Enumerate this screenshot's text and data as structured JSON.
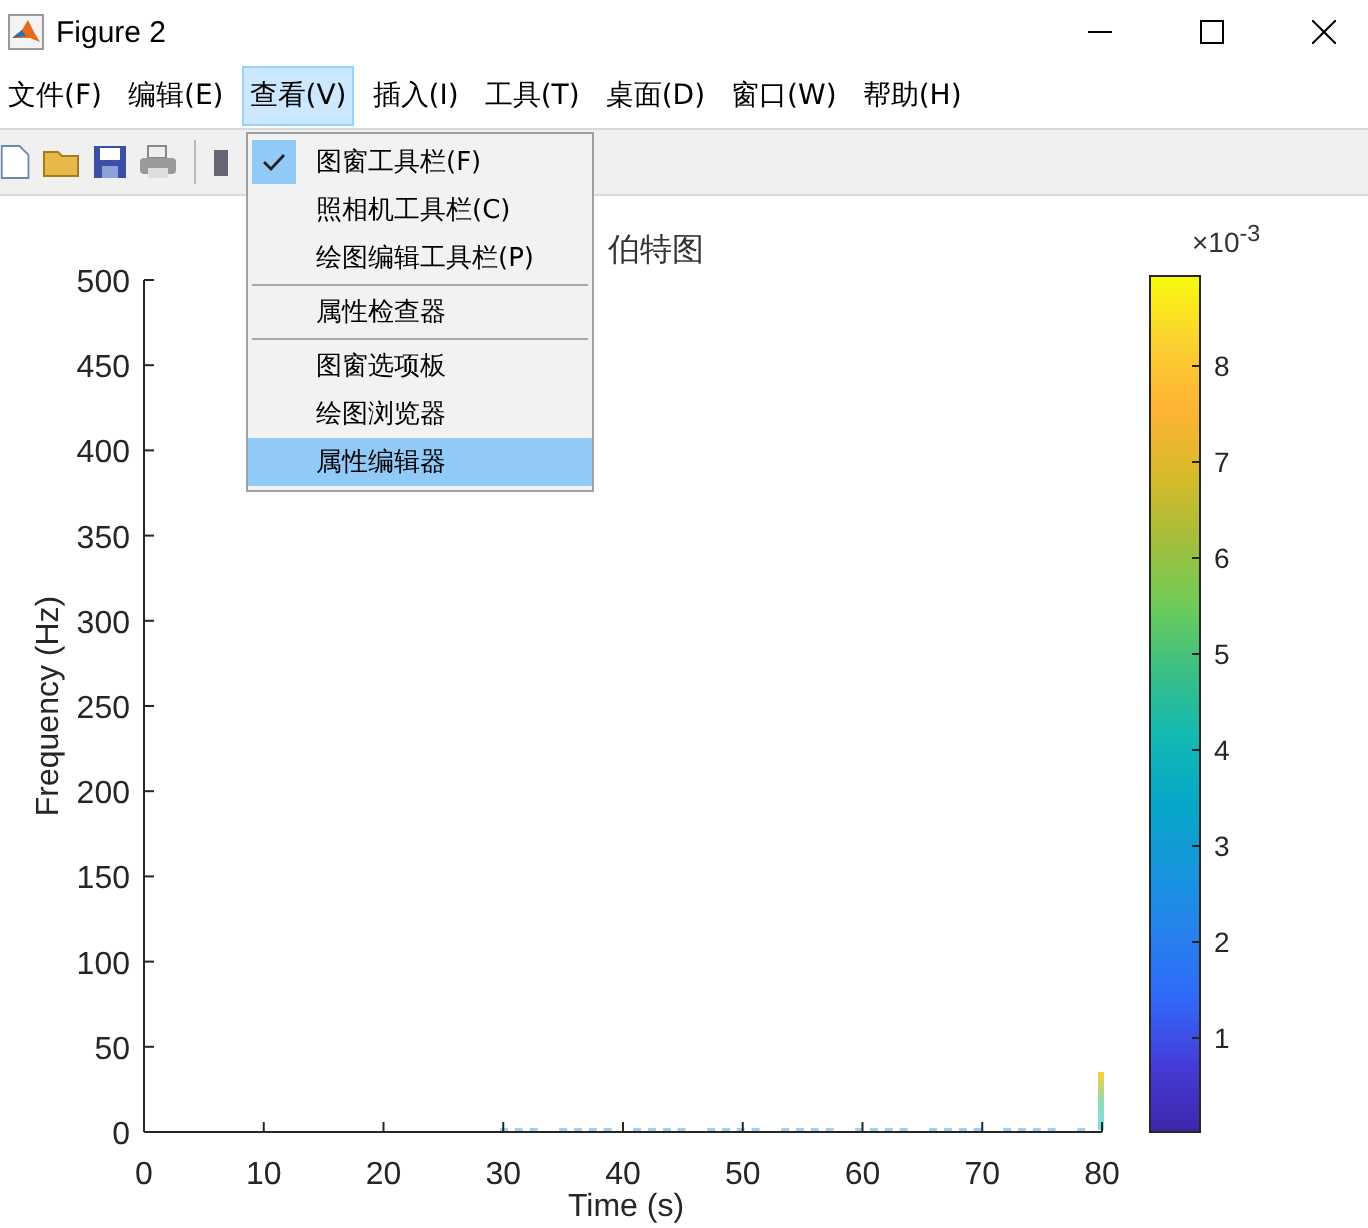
{
  "window": {
    "title": "Figure 2"
  },
  "menu_bar": [
    {
      "label": "文件(F)",
      "selected": false
    },
    {
      "label": "编辑(E)",
      "selected": false
    },
    {
      "label": "查看(V)",
      "selected": true
    },
    {
      "label": "插入(I)",
      "selected": false
    },
    {
      "label": "工具(T)",
      "selected": false
    },
    {
      "label": "桌面(D)",
      "selected": false
    },
    {
      "label": "窗口(W)",
      "selected": false
    },
    {
      "label": "帮助(H)",
      "selected": false
    }
  ],
  "view_menu": {
    "sections": [
      [
        {
          "label": "图窗工具栏(F)",
          "checked": true,
          "selected": false
        },
        {
          "label": "照相机工具栏(C)",
          "checked": false,
          "selected": false
        },
        {
          "label": "绘图编辑工具栏(P)",
          "checked": false,
          "selected": false
        }
      ],
      [
        {
          "label": "属性检查器",
          "checked": false,
          "selected": false
        }
      ],
      [
        {
          "label": "图窗选项板",
          "checked": false,
          "selected": false
        },
        {
          "label": "绘图浏览器",
          "checked": false,
          "selected": false
        },
        {
          "label": "属性编辑器",
          "checked": false,
          "selected": true
        }
      ]
    ]
  },
  "plot": {
    "title": "伯特图",
    "xlabel": "Time (s)",
    "ylabel": "Frequency (Hz)",
    "xticks": [
      "0",
      "10",
      "20",
      "30",
      "40",
      "50",
      "60",
      "70",
      "80"
    ],
    "yticks": [
      "500",
      "450",
      "400",
      "350",
      "300",
      "250",
      "200",
      "150",
      "100",
      "50",
      "0"
    ],
    "colorbar": {
      "exponent": "×10$^{-3}$",
      "ticks": [
        "8",
        "7",
        "6",
        "5",
        "4",
        "3",
        "2",
        "1"
      ]
    }
  }
}
